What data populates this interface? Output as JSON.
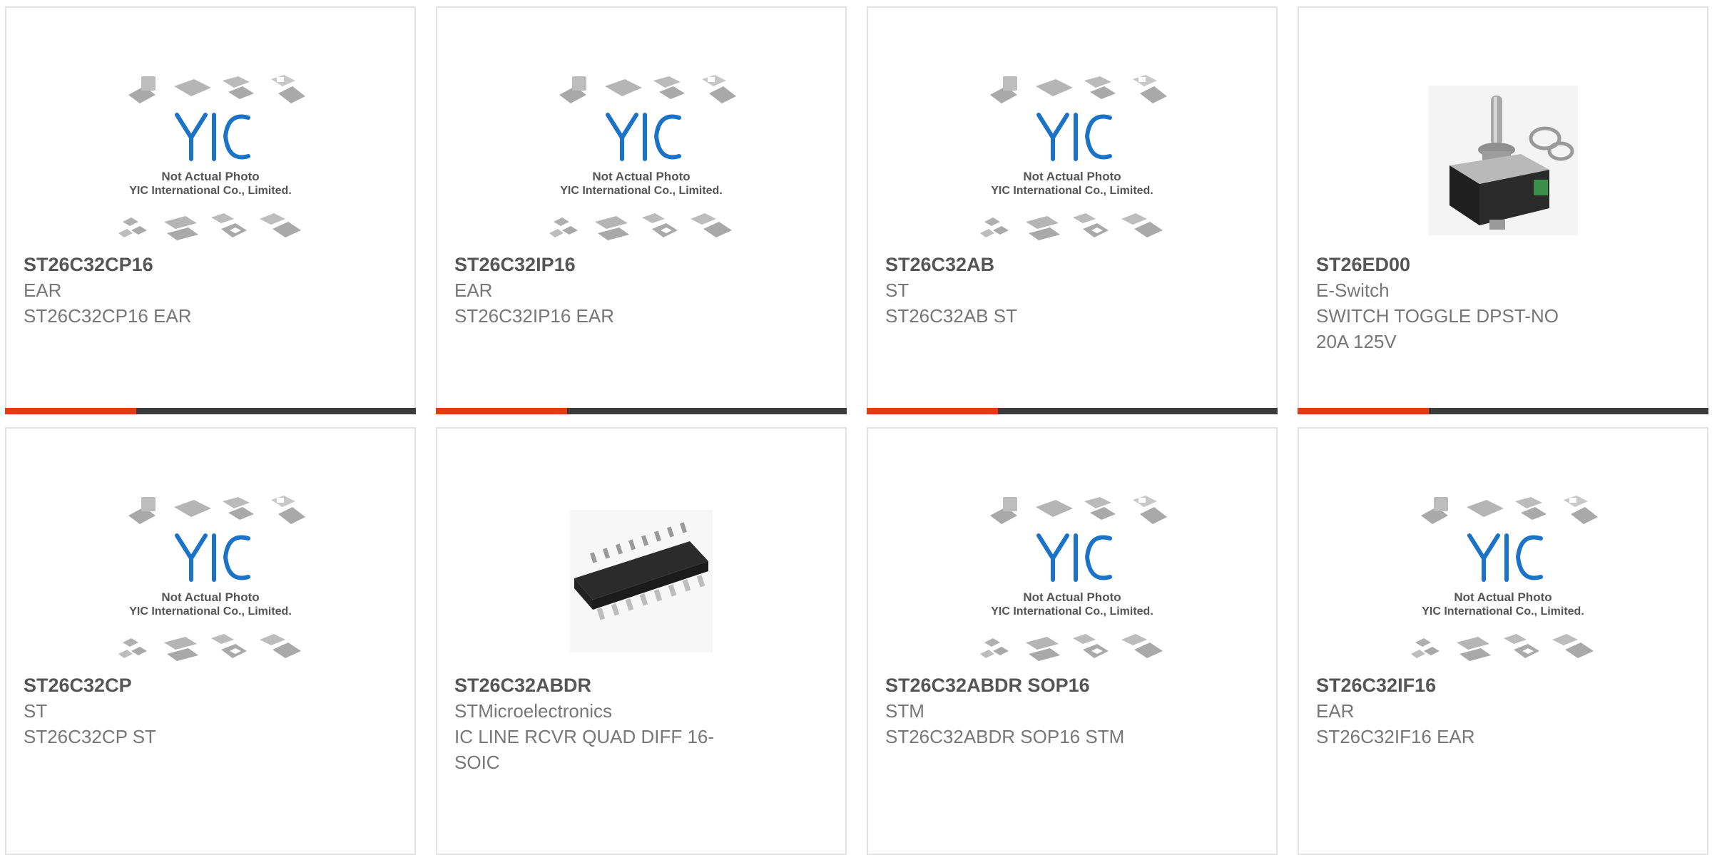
{
  "products": [
    {
      "part": "ST26C32CP16",
      "manufacturer": "EAR",
      "description": "ST26C32CP16 EAR",
      "image": "placeholder"
    },
    {
      "part": "ST26C32IP16",
      "manufacturer": "EAR",
      "description": "ST26C32IP16 EAR",
      "image": "placeholder"
    },
    {
      "part": "ST26C32AB",
      "manufacturer": "ST",
      "description": "ST26C32AB ST",
      "image": "placeholder"
    },
    {
      "part": "ST26ED00",
      "manufacturer": "E-Switch",
      "description": "SWITCH TOGGLE DPST-NO 20A 125V",
      "image": "toggle-switch-photo"
    },
    {
      "part": "ST26C32CP",
      "manufacturer": "ST",
      "description": "ST26C32CP ST",
      "image": "placeholder"
    },
    {
      "part": "ST26C32ABDR",
      "manufacturer": "STMicroelectronics",
      "description": "IC LINE RCVR QUAD DIFF 16-SOIC",
      "image": "soic-chip-photo"
    },
    {
      "part": "ST26C32ABDR SOP16",
      "manufacturer": "STM",
      "description": "ST26C32ABDR SOP16 STM",
      "image": "placeholder"
    },
    {
      "part": "ST26C32IF16",
      "manufacturer": "EAR",
      "description": "ST26C32IF16 EAR",
      "image": "placeholder"
    }
  ],
  "placeholder": {
    "logo": "YIC",
    "line1": "Not Actual Photo",
    "line2": "YIC International Co., Limited."
  },
  "colors": {
    "accent": "#e53a16",
    "bar": "#3b3b3b",
    "logo_blue": "#1a73c9"
  }
}
